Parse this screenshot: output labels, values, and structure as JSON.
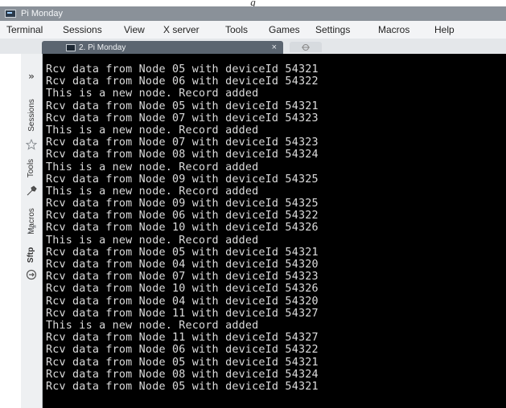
{
  "caption": "g",
  "window": {
    "title": "Pi Monday"
  },
  "menu": {
    "terminal": "Terminal",
    "sessions": "Sessions",
    "view": "View",
    "xserver": "X server",
    "tools": "Tools",
    "games": "Games",
    "settings": "Settings",
    "macros": "Macros",
    "help": "Help"
  },
  "tab": {
    "label": "2. Pi Monday",
    "close": "×"
  },
  "sidebar": {
    "chevron": "»",
    "sessions": "Sessions",
    "tools": "Tools",
    "macros": "Macros",
    "sftp": "Sftp"
  },
  "icons": {
    "app": "terminal-app-icon",
    "tab": "terminal-tab-icon",
    "new_tab": "new-tab-icon",
    "star": "star-icon",
    "tools": "tools-icon",
    "macros": "macros-icon",
    "sftp": "sftp-icon"
  },
  "colors": {
    "terminal_bg": "#000000",
    "terminal_fg": "#dcdcdc",
    "titlebar": "#8a9199",
    "tab_active": "#5b6570"
  },
  "terminal": {
    "lines": [
      "Rcv data from Node 05 with deviceId 54321",
      "Rcv data from Node 06 with deviceId 54322",
      "This is a new node. Record added",
      "Rcv data from Node 05 with deviceId 54321",
      "Rcv data from Node 07 with deviceId 54323",
      "This is a new node. Record added",
      "Rcv data from Node 07 with deviceId 54323",
      "Rcv data from Node 08 with deviceId 54324",
      "This is a new node. Record added",
      "Rcv data from Node 09 with deviceId 54325",
      "This is a new node. Record added",
      "Rcv data from Node 09 with deviceId 54325",
      "Rcv data from Node 06 with deviceId 54322",
      "Rcv data from Node 10 with deviceId 54326",
      "This is a new node. Record added",
      "Rcv data from Node 05 with deviceId 54321",
      "Rcv data from Node 04 with deviceId 54320",
      "Rcv data from Node 07 with deviceId 54323",
      "Rcv data from Node 10 with deviceId 54326",
      "Rcv data from Node 04 with deviceId 54320",
      "Rcv data from Node 11 with deviceId 54327",
      "This is a new node. Record added",
      "Rcv data from Node 11 with deviceId 54327",
      "Rcv data from Node 06 with deviceId 54322",
      "Rcv data from Node 05 with deviceId 54321",
      "Rcv data from Node 08 with deviceId 54324",
      "Rcv data from Node 05 with deviceId 54321"
    ]
  }
}
